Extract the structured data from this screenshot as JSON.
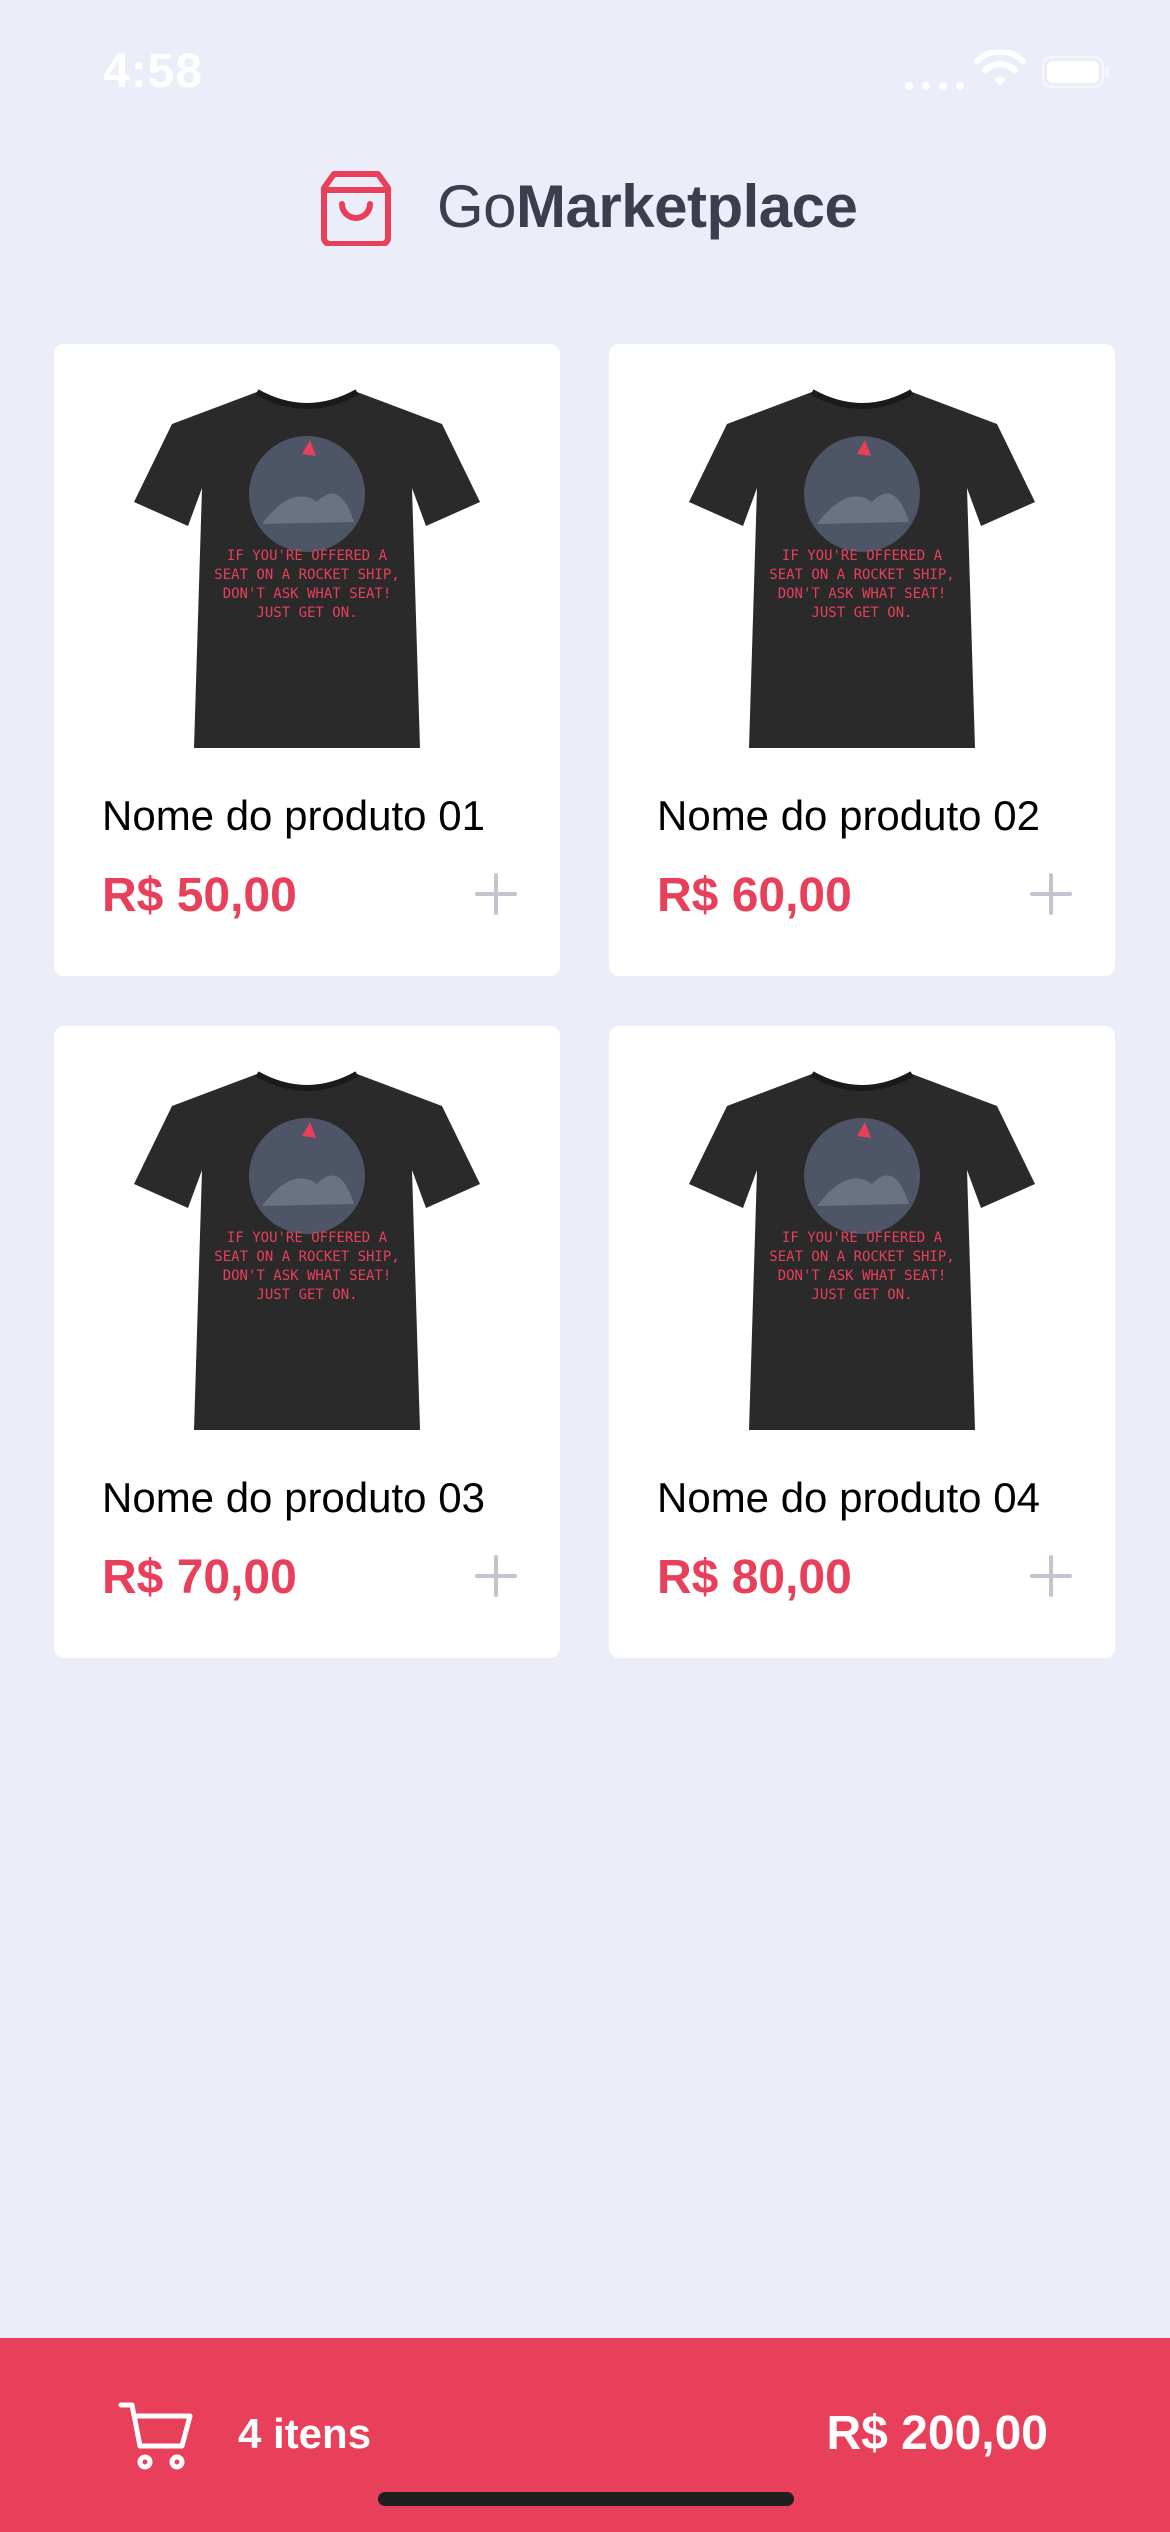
{
  "status_bar": {
    "time": "4:58"
  },
  "header": {
    "brand_light": "Go",
    "brand_bold": "Marketplace",
    "icon": "shopping-bag-icon"
  },
  "products": [
    {
      "title": "Nome do produto 01",
      "price": "R$ 50,00"
    },
    {
      "title": "Nome do produto 02",
      "price": "R$ 60,00"
    },
    {
      "title": "Nome do produto 03",
      "price": "R$ 70,00"
    },
    {
      "title": "Nome do produto 04",
      "price": "R$ 80,00"
    }
  ],
  "product_image_text": {
    "line1": "IF YOU'RE OFFERED A",
    "line2": "SEAT ON A ROCKET SHIP,",
    "line3": "DON'T ASK WHAT SEAT!",
    "line4": "JUST GET ON."
  },
  "cart": {
    "count_label": "4 itens",
    "total": "R$ 200,00",
    "icon": "cart-icon"
  },
  "colors": {
    "background": "#EBEEF8",
    "accent": "#E83F5B",
    "title": "#3D3D4D",
    "card": "#FFFFFF"
  }
}
